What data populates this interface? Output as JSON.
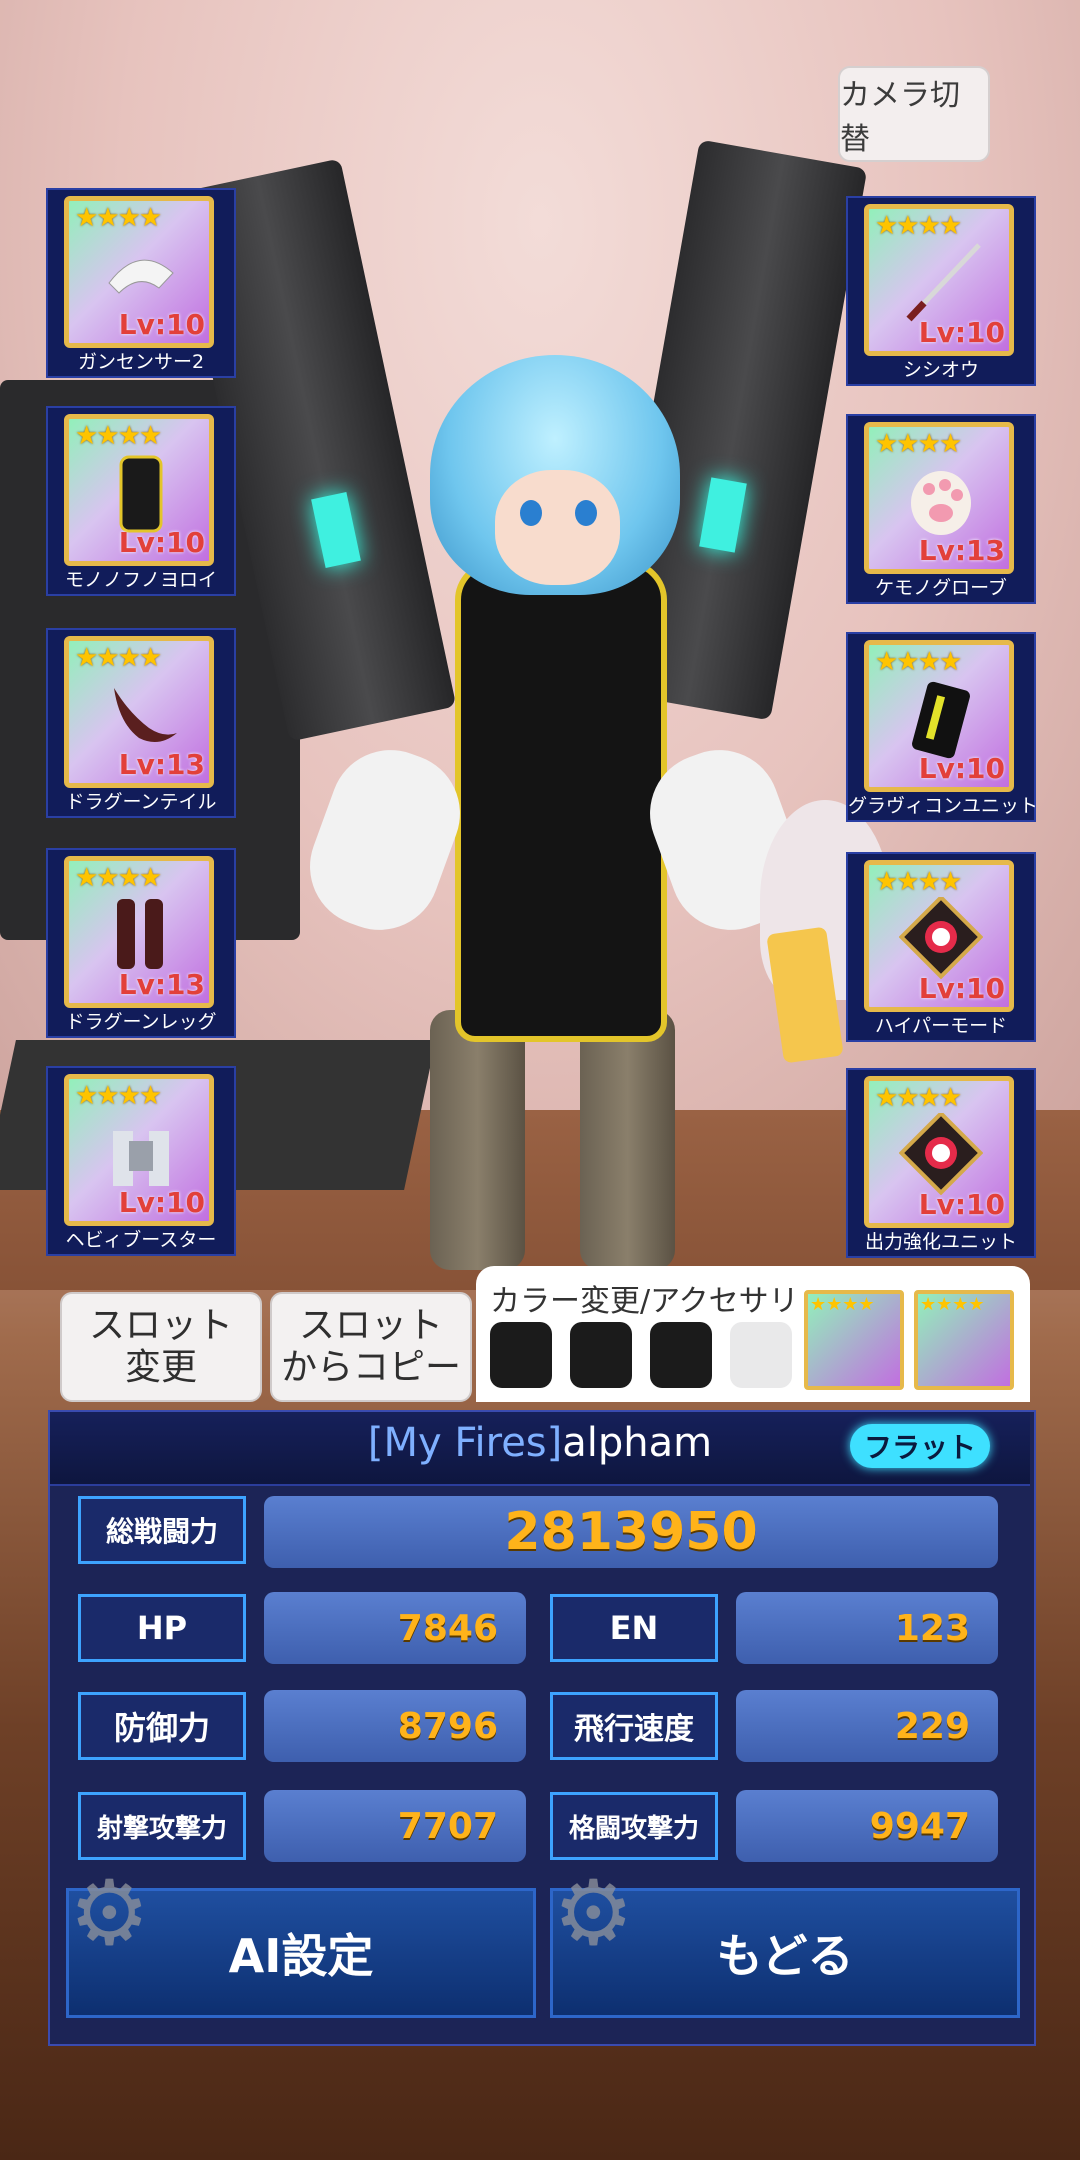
{
  "camera_button": {
    "label": "カメラ切替"
  },
  "left_slots": [
    {
      "name": "ガンセンサー2",
      "level": "Lv:10",
      "stars": "★★★★"
    },
    {
      "name": "モノノフノヨロイ",
      "level": "Lv:10",
      "stars": "★★★★"
    },
    {
      "name": "ドラグーンテイル",
      "level": "Lv:13",
      "stars": "★★★★"
    },
    {
      "name": "ドラグーンレッグ",
      "level": "Lv:13",
      "stars": "★★★★"
    },
    {
      "name": "ヘビィブースター",
      "level": "Lv:10",
      "stars": "★★★★"
    }
  ],
  "right_slots": [
    {
      "name": "シシオウ",
      "level": "Lv:10",
      "stars": "★★★★"
    },
    {
      "name": "ケモノグローブ",
      "level": "Lv:13",
      "stars": "★★★★"
    },
    {
      "name": "グラヴィコンユニット",
      "level": "Lv:10",
      "stars": "★★★★"
    },
    {
      "name": "ハイパーモード",
      "level": "Lv:10",
      "stars": "★★★★"
    },
    {
      "name": "出力強化ユニット",
      "level": "Lv:10",
      "stars": "★★★★"
    }
  ],
  "slot_change_button": {
    "line1": "スロット",
    "line2": "変更"
  },
  "slot_copy_button": {
    "line1": "スロット",
    "line2": "からコピー"
  },
  "color_panel": {
    "title": "カラー変更/アクセサリ",
    "swatches": [
      "#1b1b1b",
      "#1b1b1b",
      "#1b1b1b",
      "#e9e9ea"
    ],
    "accessory_stars": "★★★★"
  },
  "player": {
    "team": "[My Fires]",
    "name": "alpham",
    "mode_badge": "フラット"
  },
  "stats": {
    "total_power": {
      "label": "総戦闘力",
      "value": "2813950"
    },
    "hp": {
      "label": "HP",
      "value": "7846"
    },
    "en": {
      "label": "EN",
      "value": "123"
    },
    "defense": {
      "label": "防御力",
      "value": "8796"
    },
    "flight_speed": {
      "label": "飛行速度",
      "value": "229"
    },
    "shot_attack": {
      "label": "射撃攻撃力",
      "value": "7707"
    },
    "melee_attack": {
      "label": "格闘攻撃力",
      "value": "9947"
    }
  },
  "bottom_buttons": {
    "ai": "AI設定",
    "back": "もどる"
  },
  "colors": {
    "accent_value": "#ffb31a",
    "panel": "#1c2456",
    "label_border": "#3da3ff",
    "badge": "#3ee0ff"
  }
}
